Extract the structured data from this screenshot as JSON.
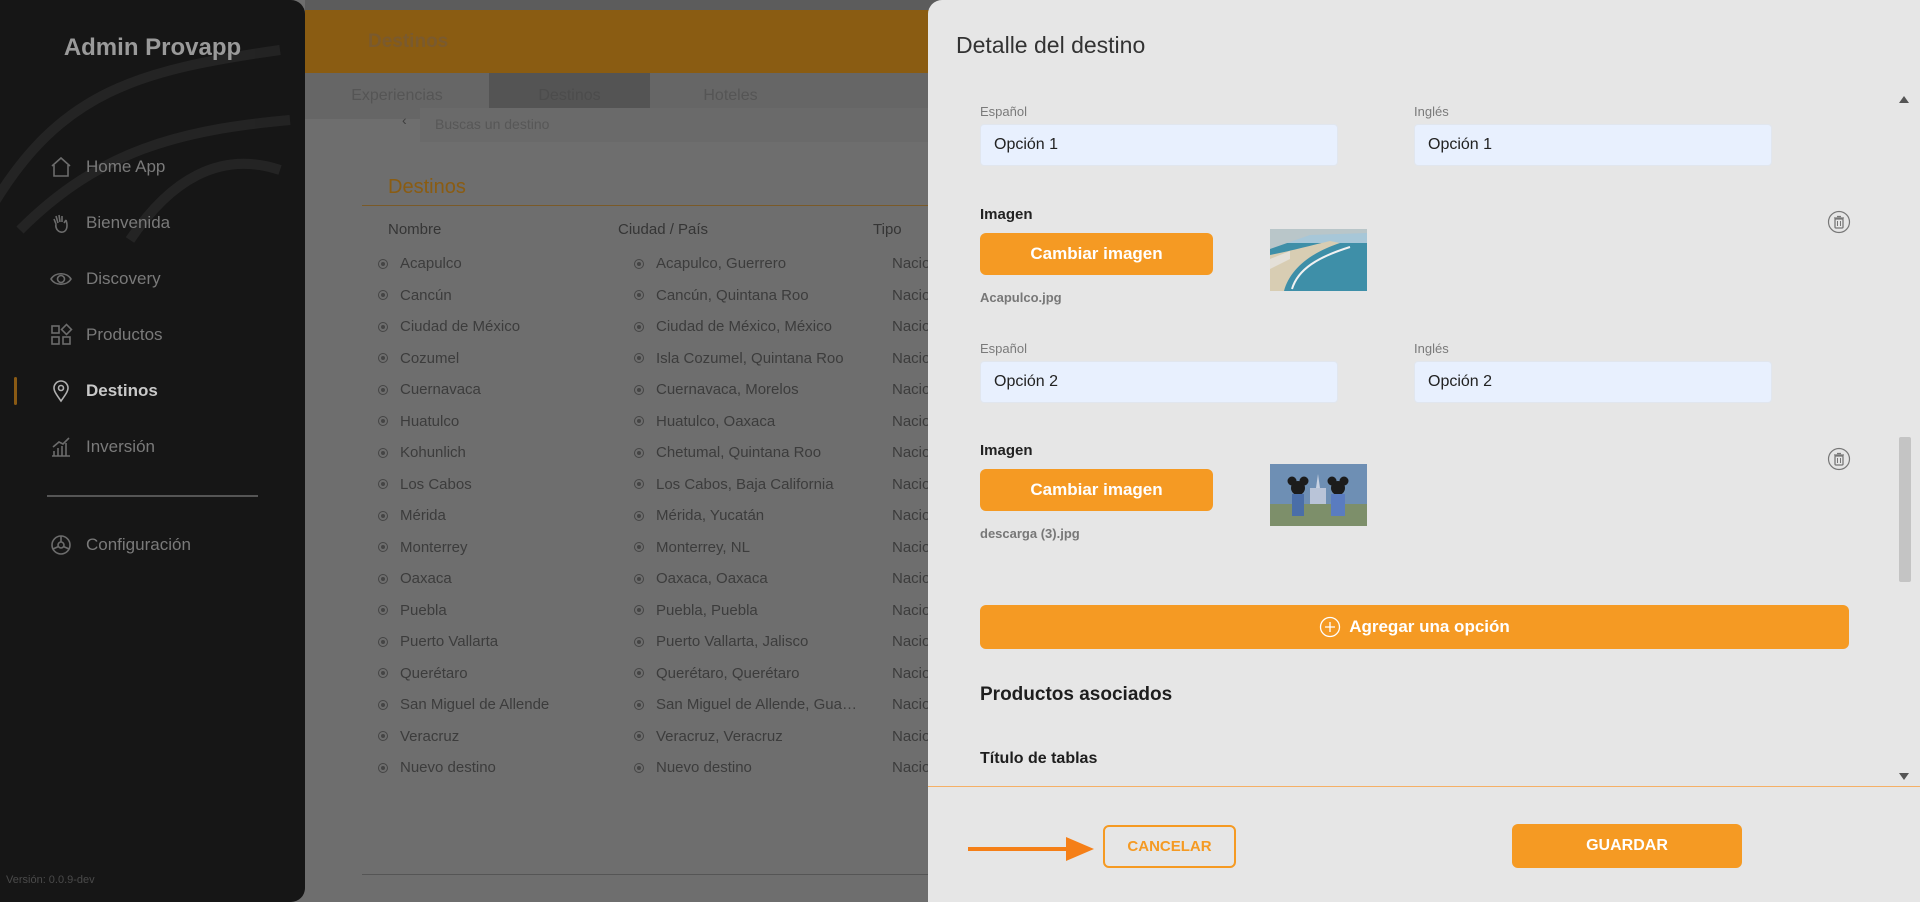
{
  "sidebar": {
    "brand": "Admin Provapp",
    "items": [
      {
        "label": "Home App",
        "icon": "home-icon"
      },
      {
        "label": "Bienvenida",
        "icon": "wave-hand-icon"
      },
      {
        "label": "Discovery",
        "icon": "eye-icon"
      },
      {
        "label": "Productos",
        "icon": "grid-icon"
      },
      {
        "label": "Destinos",
        "icon": "map-pin-icon",
        "active": true
      },
      {
        "label": "Inversión",
        "icon": "bar-chart-icon"
      }
    ],
    "config_label": "Configuración",
    "version": "Versión: 0.0.9-dev"
  },
  "background_page": {
    "header_title": "Destinos",
    "tabs": [
      "Experiencias",
      "Destinos",
      "Hoteles"
    ],
    "search_placeholder": "Buscas un destino",
    "section_title": "Destinos",
    "columns": [
      "Nombre",
      "Ciudad / País",
      "Tipo"
    ],
    "rows": [
      {
        "name": "Acapulco",
        "city": "Acapulco, Guerrero",
        "type": "Nacio"
      },
      {
        "name": "Cancún",
        "city": "Cancún, Quintana Roo",
        "type": "Nacio"
      },
      {
        "name": "Ciudad de México",
        "city": "Ciudad de México, México",
        "type": "Nacio"
      },
      {
        "name": "Cozumel",
        "city": "Isla Cozumel, Quintana Roo",
        "type": "Nacio"
      },
      {
        "name": "Cuernavaca",
        "city": "Cuernavaca, Morelos",
        "type": "Nacio"
      },
      {
        "name": "Huatulco",
        "city": "Huatulco, Oaxaca",
        "type": "Nacio"
      },
      {
        "name": "Kohunlich",
        "city": "Chetumal, Quintana Roo",
        "type": "Nacio"
      },
      {
        "name": "Los Cabos",
        "city": "Los Cabos, Baja California",
        "type": "Nacio"
      },
      {
        "name": "Mérida",
        "city": "Mérida, Yucatán",
        "type": "Nacio"
      },
      {
        "name": "Monterrey",
        "city": "Monterrey, NL",
        "type": "Nacio"
      },
      {
        "name": "Oaxaca",
        "city": "Oaxaca, Oaxaca",
        "type": "Nacio"
      },
      {
        "name": "Puebla",
        "city": "Puebla, Puebla",
        "type": "Nacio"
      },
      {
        "name": "Puerto Vallarta",
        "city": "Puerto Vallarta, Jalisco",
        "type": "Nacio"
      },
      {
        "name": "Querétaro",
        "city": "Querétaro, Querétaro",
        "type": "Nacio"
      },
      {
        "name": "San Miguel de Allende",
        "city": "San Miguel de Allende, Gua…",
        "type": "Nacio"
      },
      {
        "name": "Veracruz",
        "city": "Veracruz, Veracruz",
        "type": "Nacio"
      },
      {
        "name": "Nuevo destino",
        "city": "Nuevo destino",
        "type": "Nacio"
      }
    ]
  },
  "modal": {
    "title": "Detalle del destino",
    "options": [
      {
        "label_es": "Español",
        "label_en": "Inglés",
        "value_es": "Opción 1",
        "value_en": "Opción 1",
        "image_label": "Imagen",
        "change_image": "Cambiar imagen",
        "filename": "Acapulco.jpg"
      },
      {
        "label_es": "Español",
        "label_en": "Inglés",
        "value_es": "Opción 2",
        "value_en": "Opción 2",
        "image_label": "Imagen",
        "change_image": "Cambiar imagen",
        "filename": "descarga (3).jpg"
      }
    ],
    "add_option": "Agregar una opción",
    "products_title": "Productos asociados",
    "tables_title": "Título de tablas",
    "cancel": "CANCELAR",
    "save": "GUARDAR"
  },
  "colors": {
    "accent": "#f59a23",
    "sidebar": "#161616",
    "modal_bg": "#e6e6e6",
    "input_bg": "#e8f0fe"
  }
}
